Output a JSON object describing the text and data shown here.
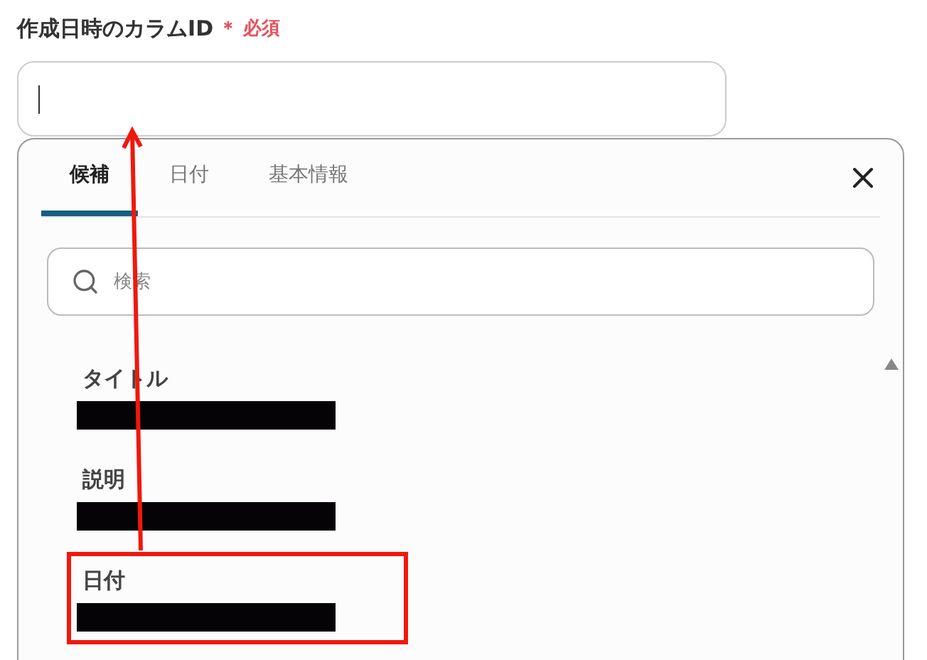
{
  "field": {
    "label": "作成日時のカラムID",
    "required_mark": "＊",
    "required_text": "必須"
  },
  "dropdown": {
    "tabs": [
      {
        "label": "候補",
        "selected": true
      },
      {
        "label": "日付",
        "selected": false
      },
      {
        "label": "基本情報",
        "selected": false
      }
    ],
    "search": {
      "placeholder": "検索"
    },
    "items": [
      {
        "title": "タイトル",
        "highlighted": false
      },
      {
        "title": "説明",
        "highlighted": false
      },
      {
        "title": "日付",
        "highlighted": true
      }
    ]
  }
}
